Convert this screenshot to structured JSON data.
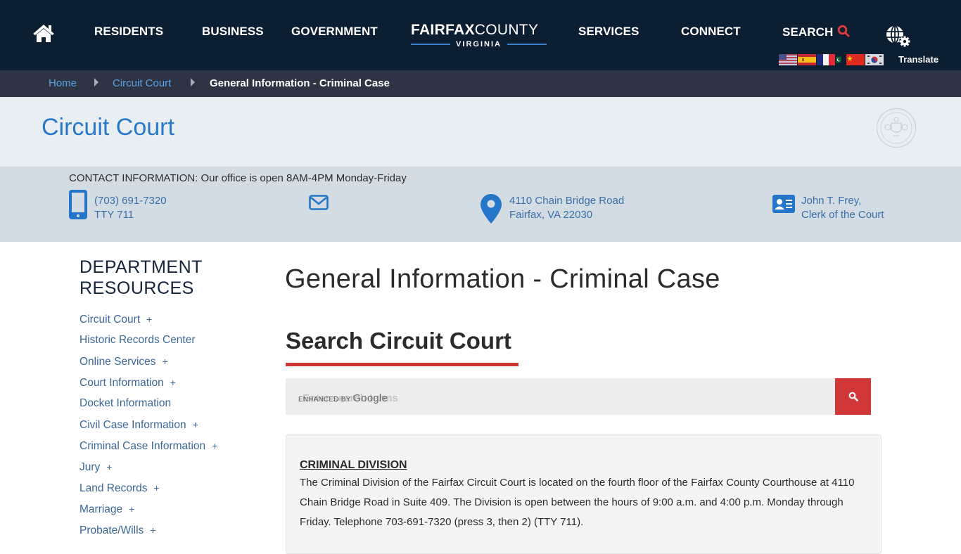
{
  "nav": {
    "items": [
      {
        "label": "RESIDENTS"
      },
      {
        "label": "BUSINESS"
      },
      {
        "label": "GOVERNMENT"
      },
      {
        "label": "SERVICES"
      },
      {
        "label": "CONNECT"
      },
      {
        "label": "SEARCH"
      }
    ],
    "logo": {
      "bold": "FAIRFAX",
      "light": "COUNTY",
      "sub": "VIRGINIA"
    },
    "icons": {
      "home": "home-icon",
      "search": "search-icon",
      "globe": "globe-gear-icon"
    },
    "flags": [
      "United States",
      "Spain",
      "France",
      "Pakistan",
      "China",
      "South Korea"
    ],
    "translate_label": "Translate"
  },
  "breadcrumb": {
    "items": [
      {
        "label": "Home"
      },
      {
        "label": "Circuit Court"
      },
      {
        "label": "General Information - Criminal Case"
      }
    ]
  },
  "banner": {
    "title": "Circuit Court",
    "seal": "county-seal"
  },
  "contact": {
    "heading": "CONTACT INFORMATION: Our office is open 8AM-4PM Monday-Friday",
    "phone": {
      "line1": "(703) 691-7320",
      "line2": "TTY 711",
      "icon": "mobile-phone-icon"
    },
    "email": {
      "icon": "envelope-icon"
    },
    "address": {
      "line1": "4110 Chain Bridge Road",
      "line2": "Fairfax, VA 22030",
      "icon": "map-marker-icon"
    },
    "clerk": {
      "line1": "John T. Frey,",
      "line2": "Clerk of the Court",
      "icon": "id-card-icon"
    }
  },
  "sidebar": {
    "title_line1": "DEPARTMENT",
    "title_line2": "RESOURCES",
    "items": [
      {
        "label": "Circuit Court",
        "expand": "+"
      },
      {
        "label": "Historic Records Center",
        "expand": ""
      },
      {
        "label": "Online Services",
        "expand": "+"
      },
      {
        "label": "Court Information",
        "expand": "+"
      },
      {
        "label": "Docket Information",
        "expand": ""
      },
      {
        "label": "Civil Case Information",
        "expand": "+"
      },
      {
        "label": "Criminal Case Information",
        "expand": "+"
      },
      {
        "label": "Jury",
        "expand": "+"
      },
      {
        "label": "Land Records",
        "expand": "+"
      },
      {
        "label": "Marriage",
        "expand": "+"
      },
      {
        "label": "Probate/Wills",
        "expand": "+"
      }
    ]
  },
  "main": {
    "page_title": "General Information - Criminal Case",
    "search_title": "Search Circuit Court",
    "search": {
      "placeholder": "Enter search terms",
      "value": "",
      "enhanced_label": "ENHANCED BY",
      "enhanced_brand": "Google"
    },
    "card": {
      "heading": "CRIMINAL DIVISION",
      "body": "The Criminal Division of the Fairfax Circuit Court is located on the fourth floor of the Fairfax County Courthouse at 4110 Chain Bridge Road in Suite 409. The Division is open between the hours of 9:00 a.m. and 4:00 p.m. Monday through Friday. Telephone 703-691-7320 (press 3, then 2) (TTY 711)."
    }
  },
  "colors": {
    "nav_bg": "#0c1f32",
    "breadcrumb_bg": "#2e3444",
    "accent_blue": "#2a78c6",
    "accent_red": "#cf3737",
    "contact_bg": "#d3dce3"
  }
}
